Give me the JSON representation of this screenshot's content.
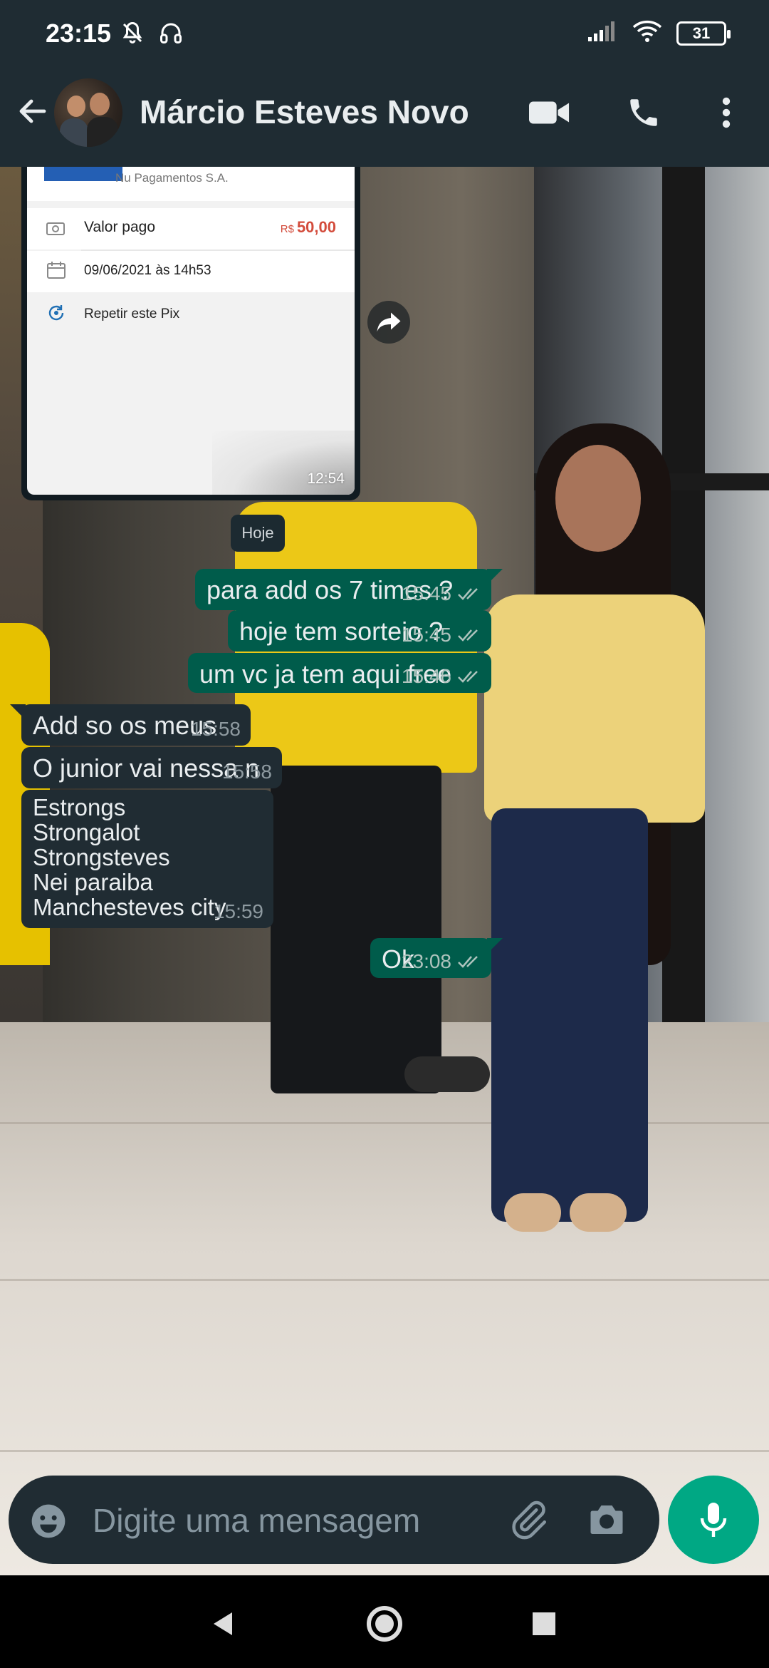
{
  "status_bar": {
    "time": "23:15",
    "battery": "31"
  },
  "header": {
    "contact_name": "Márcio Esteves Novo"
  },
  "image_message": {
    "bank_name": "Nu Pagamentos S.A.",
    "valor_label": "Valor pago",
    "valor_currency": "R$",
    "valor_amount": "50,00",
    "date_value": "09/06/2021 às 14h53",
    "repeat_label": "Repetir este Pix",
    "time": "12:54"
  },
  "date_chip": "Hoje",
  "messages": [
    {
      "dir": "out",
      "text": "para add os 7 times ?",
      "time": "15:45"
    },
    {
      "dir": "out",
      "text": "hoje tem sorteio ?",
      "time": "15:45"
    },
    {
      "dir": "out",
      "text": "um vc ja tem aqui free",
      "time": "15:46"
    },
    {
      "dir": "in",
      "text": "Add so os meus",
      "time": "15:58"
    },
    {
      "dir": "in",
      "text": "O junior vai nessa n",
      "time": "15:58"
    },
    {
      "dir": "in",
      "text": "Estrongs\nStrongalot\nStrongsteves\nNei paraiba\nManchesteves city",
      "time": "15:59"
    },
    {
      "dir": "out",
      "text": "Ok",
      "time": "23:08"
    }
  ],
  "input": {
    "placeholder": "Digite uma mensagem"
  },
  "colors": {
    "header": "#1f2c33",
    "outgoing": "#005c4b",
    "incoming": "#202c33",
    "accent": "#00a884"
  }
}
